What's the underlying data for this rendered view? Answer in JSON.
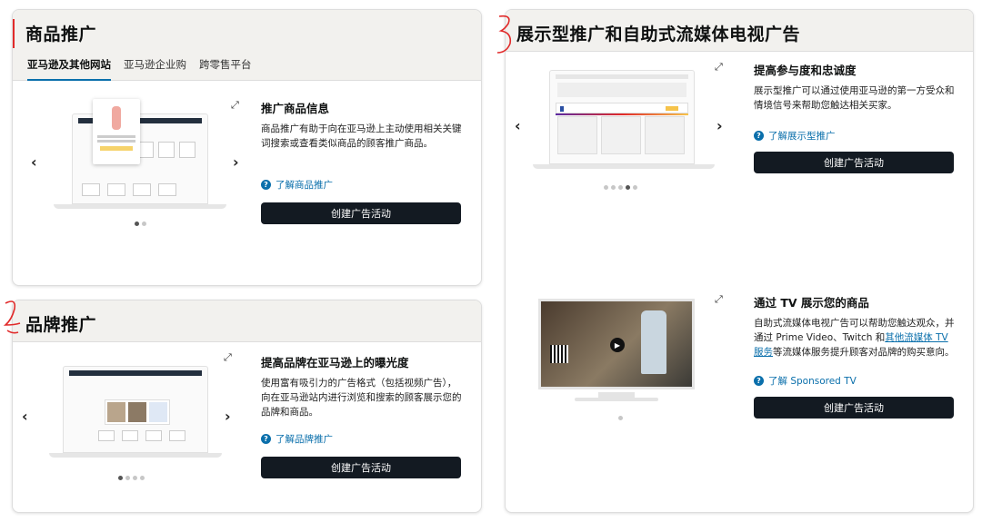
{
  "product_promo": {
    "title": "商品推广",
    "tabs": [
      "亚马逊及其他网站",
      "亚马逊企业购",
      "跨零售平台"
    ],
    "feature_title": "推广商品信息",
    "feature_desc": "商品推广有助于向在亚马逊上主动使用相关关键词搜索或查看类似商品的顾客推广商品。",
    "learn_link": "了解商品推广",
    "cta": "创建广告活动"
  },
  "brand_promo": {
    "title": "品牌推广",
    "feature_title": "提高品牌在亚马逊上的曝光度",
    "feature_desc": "使用富有吸引力的广告格式（包括视频广告），向在亚马逊站内进行浏览和搜索的顾客展示您的品牌和商品。",
    "learn_link": "了解品牌推广",
    "cta": "创建广告活动"
  },
  "display_promo": {
    "title": "展示型推广和自助式流媒体电视广告",
    "feature1_title": "提高参与度和忠诚度",
    "feature1_desc": "展示型推广可以通过使用亚马逊的第一方受众和情境信号来帮助您触达相关买家。",
    "learn1_link": "了解展示型推广",
    "cta1": "创建广告活动",
    "feature2_title": "通过 TV 展示您的商品",
    "feature2_desc_prefix": "自助式流媒体电视广告可以帮助您触达观众，并通过 Prime Video、Twitch 和",
    "feature2_desc_link": "其他流媒体 TV 服务",
    "feature2_desc_suffix": "等流媒体服务提升顾客对品牌的购买意向。",
    "learn2_link": "了解 Sponsored TV",
    "cta2": "创建广告活动"
  },
  "icons": {
    "arrow_left": "‹",
    "arrow_right": "›",
    "expand": "⤢",
    "question": "?"
  },
  "colors": {
    "link": "#0a6fab",
    "button_bg": "#131a22",
    "header_bg": "#f2f1ee",
    "annotation_red": "#e12a2a"
  }
}
